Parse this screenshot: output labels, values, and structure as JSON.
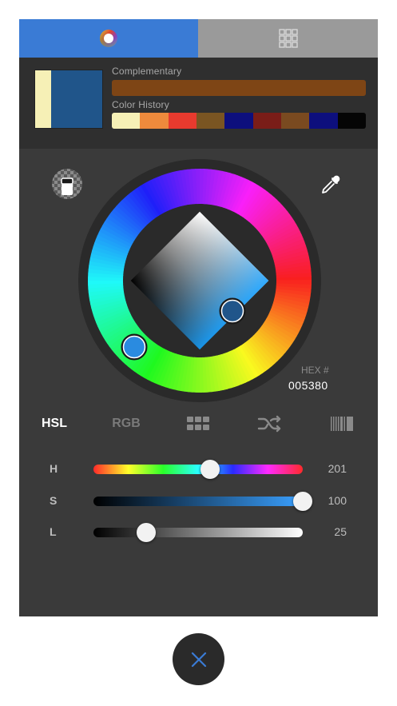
{
  "tabs": [
    {
      "icon": "color-wheel-icon",
      "active": true
    },
    {
      "icon": "grid-icon",
      "active": false
    }
  ],
  "colors": {
    "current": "#20558a",
    "previous": "#f6f0b6",
    "complementary": "#7e4515",
    "accent": "#3a7bd5"
  },
  "labels": {
    "complementary": "Complementary",
    "history": "Color History"
  },
  "history": [
    "#f6f0b6",
    "#ee8a3c",
    "#e83a2e",
    "#7a5522",
    "#0d0f7d",
    "#7a1d18",
    "#7a4a20",
    "#0d0f7d",
    "#050505"
  ],
  "hex": {
    "label": "HEX #",
    "value": "005380"
  },
  "modes": [
    {
      "label": "HSL",
      "active": true
    },
    {
      "label": "RGB",
      "active": false
    },
    {
      "icon": "palette-grid-icon"
    },
    {
      "icon": "shuffle-icon"
    },
    {
      "icon": "barcode-icon"
    }
  ],
  "sliders": [
    {
      "name": "H",
      "value": "201",
      "fraction": 0.558
    },
    {
      "name": "S",
      "value": "100",
      "fraction": 1.0
    },
    {
      "name": "L",
      "value": "25",
      "fraction": 0.25
    }
  ],
  "close_icon": "close-icon"
}
